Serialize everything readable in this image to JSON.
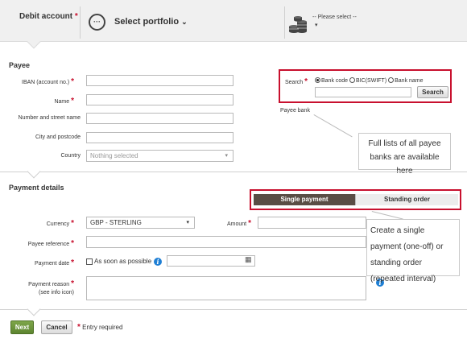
{
  "debit": {
    "label": "Debit account",
    "required_mark": "*",
    "portfolio_icon": "···",
    "portfolio_label": "Select portfolio",
    "portfolio_caret": "⌄",
    "currency_placeholder": "-- Please select --",
    "currency_caret": "▾"
  },
  "payee": {
    "title": "Payee",
    "iban_label": "IBAN (account no.)",
    "name_label": "Name",
    "street_label": "Number and street name",
    "city_label": "City and postcode",
    "country_label": "Country",
    "country_value": "Nothing selected",
    "country_caret": "▾",
    "search": {
      "label": "Search",
      "options": [
        "Bank code",
        "BIC(SWIFT)",
        "Bank name"
      ],
      "selected_index": 0,
      "button": "Search"
    },
    "payee_bank_label": "Payee bank",
    "tooltip": "Full lists of all payee banks are available here"
  },
  "payment": {
    "title": "Payment details",
    "tabs": [
      "Single payment",
      "Standing order"
    ],
    "active_tab": 0,
    "currency_label": "Currency",
    "currency_value": "GBP - STERLING",
    "currency_caret": "▾",
    "amount_label": "Amount",
    "reference_label": "Payee reference",
    "date_label": "Payment date",
    "asap_label": "As soon as possible",
    "reason_label": "Payment reason",
    "reason_hint": "(see info icon)",
    "info_glyph": "i",
    "calendar_glyph": "▦",
    "tooltip": "Create a single payment (one-off) or standing order (repeated interval)"
  },
  "footer": {
    "next": "Next",
    "cancel": "Cancel",
    "required_note": "Entry required"
  },
  "colors": {
    "required": "#c8102e",
    "active_tab": "#5a4d45",
    "next_button": "#6b9537",
    "info": "#1f7fd4"
  }
}
